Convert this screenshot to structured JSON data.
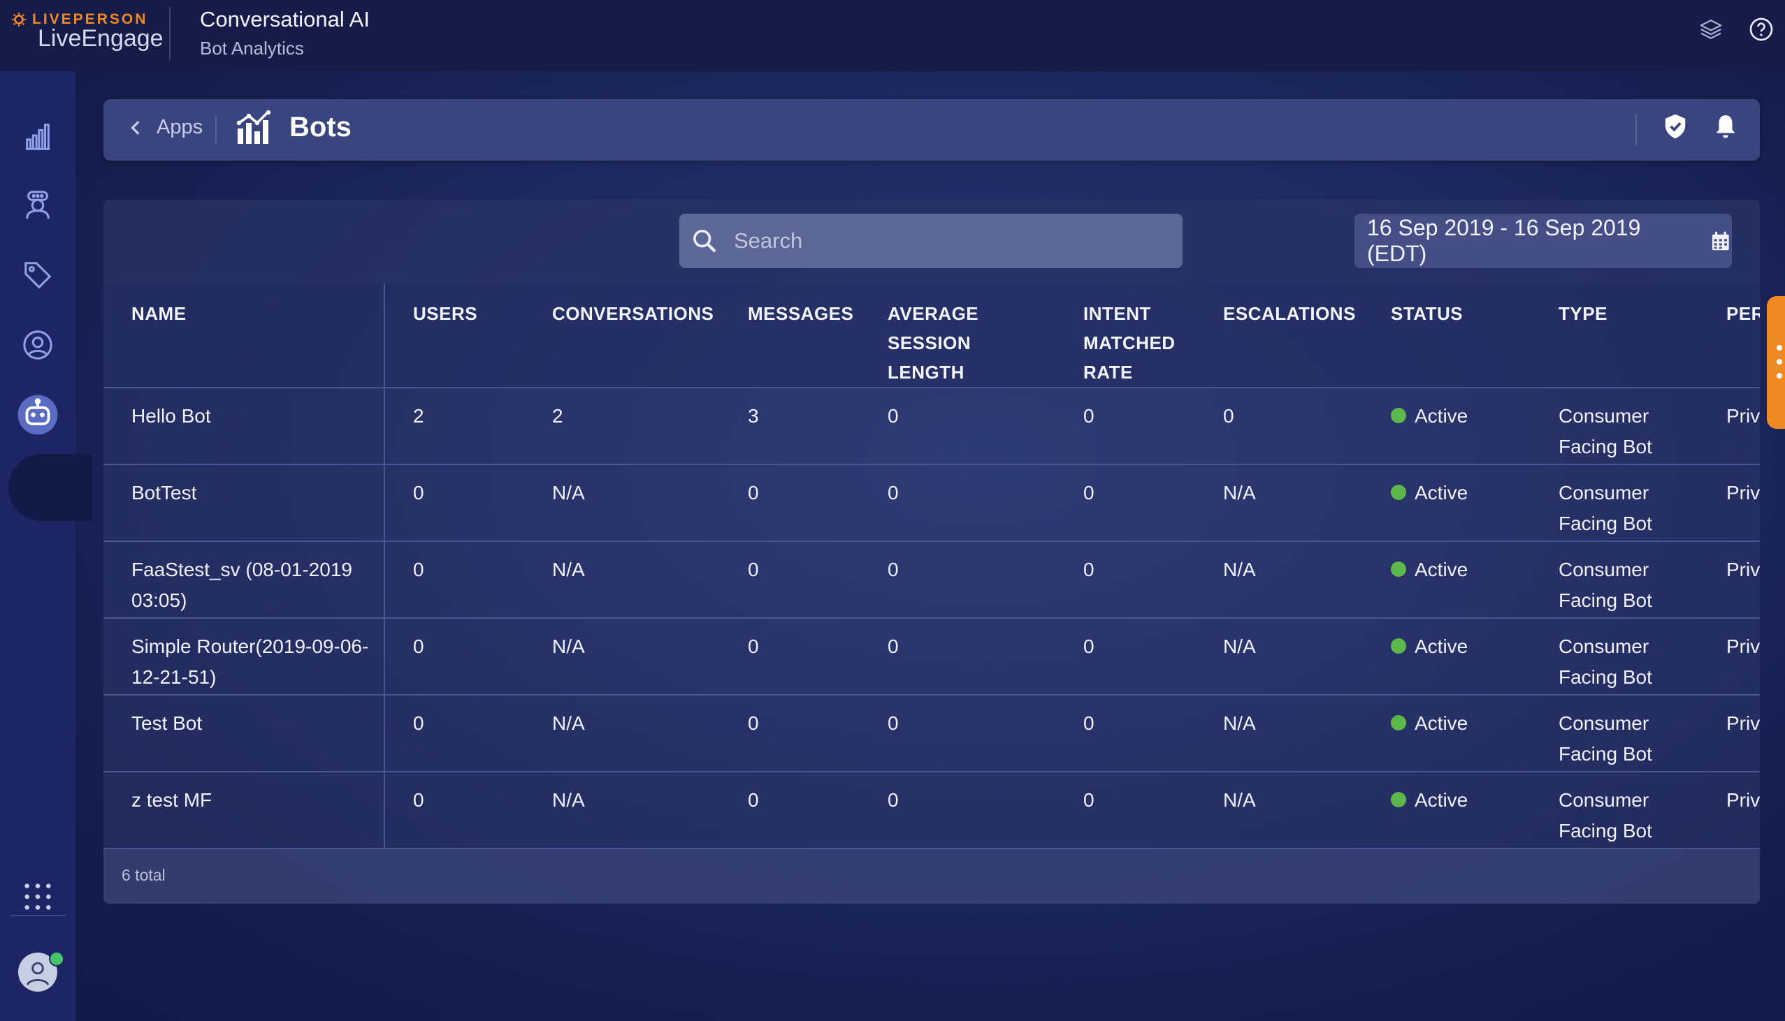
{
  "brand": {
    "company": "LIVEPERSON",
    "product": "LiveEngage"
  },
  "app": {
    "title": "Conversational AI",
    "subtitle": "Bot Analytics"
  },
  "top_icons": [
    "layers-icon",
    "help-icon"
  ],
  "sidebar": {
    "items": [
      {
        "icon": "analytics-icon"
      },
      {
        "icon": "agent-icon"
      },
      {
        "icon": "tag-icon"
      },
      {
        "icon": "user-circle-icon"
      },
      {
        "icon": "bot-icon",
        "active": true
      }
    ],
    "bottom": [
      {
        "icon": "apps-grid-icon"
      },
      {
        "icon": "avatar"
      }
    ]
  },
  "header": {
    "back_label": "Apps",
    "title": "Bots",
    "icons": [
      "shield-icon",
      "bell-icon"
    ]
  },
  "search": {
    "placeholder": "Search"
  },
  "date_range": {
    "label": "16 Sep 2019 - 16 Sep 2019 (EDT)"
  },
  "table": {
    "headers": {
      "name": "NAME",
      "users": "USERS",
      "conversations": "CONVERSATIONS",
      "messages": "MESSAGES",
      "avg_session": "AVERAGE SESSION LENGTH",
      "intent_rate": "INTENT MATCHED RATE",
      "escalations": "ESCALATIONS",
      "status": "STATUS",
      "type": "TYPE",
      "per": "PER"
    },
    "rows": [
      {
        "name": "Hello Bot",
        "users": "2",
        "conversations": "2",
        "messages": "3",
        "avg_session": "0",
        "intent_rate": "0",
        "escalations": "0",
        "status": "Active",
        "type": "Consumer Facing Bot",
        "per": "Priv"
      },
      {
        "name": "BotTest",
        "users": "0",
        "conversations": "N/A",
        "messages": "0",
        "avg_session": "0",
        "intent_rate": "0",
        "escalations": "N/A",
        "status": "Active",
        "type": "Consumer Facing Bot",
        "per": "Priv"
      },
      {
        "name": "FaaStest_sv (08-01-2019 03:05)",
        "users": "0",
        "conversations": "N/A",
        "messages": "0",
        "avg_session": "0",
        "intent_rate": "0",
        "escalations": "N/A",
        "status": "Active",
        "type": "Consumer Facing Bot",
        "per": "Priv"
      },
      {
        "name": "Simple Router(2019-09-06-12-21-51)",
        "users": "0",
        "conversations": "N/A",
        "messages": "0",
        "avg_session": "0",
        "intent_rate": "0",
        "escalations": "N/A",
        "status": "Active",
        "type": "Consumer Facing Bot",
        "per": "Priv"
      },
      {
        "name": "Test Bot",
        "users": "0",
        "conversations": "N/A",
        "messages": "0",
        "avg_session": "0",
        "intent_rate": "0",
        "escalations": "N/A",
        "status": "Active",
        "type": "Consumer Facing Bot",
        "per": "Priv"
      },
      {
        "name": "z test MF",
        "users": "0",
        "conversations": "N/A",
        "messages": "0",
        "avg_session": "0",
        "intent_rate": "0",
        "escalations": "N/A",
        "status": "Active",
        "type": "Consumer Facing Bot",
        "per": "Priv"
      }
    ]
  },
  "footer": {
    "total": "6 total"
  },
  "colors": {
    "accent": "#f08a24",
    "status_active": "#5cb84a",
    "topbar": "#161b48",
    "sidebar": "#1d2564"
  }
}
